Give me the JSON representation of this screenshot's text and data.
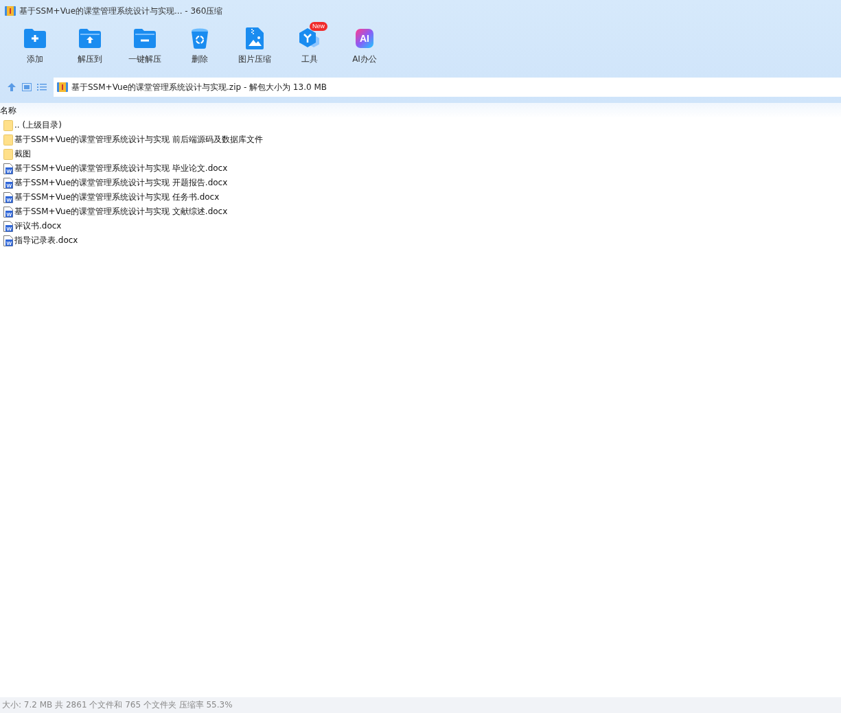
{
  "window": {
    "title": "基于SSM+Vue的课堂管理系统设计与实现... - 360压缩"
  },
  "toolbar": [
    {
      "kind": "add",
      "label": "添加"
    },
    {
      "kind": "extract-to",
      "label": "解压到"
    },
    {
      "kind": "one-click",
      "label": "一键解压"
    },
    {
      "kind": "delete",
      "label": "删除"
    },
    {
      "kind": "image",
      "label": "图片压缩"
    },
    {
      "kind": "tools",
      "label": "工具",
      "badge": "New"
    },
    {
      "kind": "ai",
      "label": "AI办公",
      "icon_text": "AI"
    }
  ],
  "path_bar": {
    "path": "基于SSM+Vue的课堂管理系统设计与实现.zip - 解包大小为 13.0 MB"
  },
  "table": {
    "columns": [
      "名称"
    ],
    "rows": [
      {
        "kind": "folder",
        "name": ".. (上级目录)"
      },
      {
        "kind": "folder",
        "name": "基于SSM+Vue的课堂管理系统设计与实现 前后端源码及数据库文件"
      },
      {
        "kind": "folder",
        "name": "截图"
      },
      {
        "kind": "docx",
        "icon_text": "W",
        "name": "基于SSM+Vue的课堂管理系统设计与实现 毕业论文.docx"
      },
      {
        "kind": "docx",
        "icon_text": "W",
        "name": "基于SSM+Vue的课堂管理系统设计与实现 开题报告.docx"
      },
      {
        "kind": "docx",
        "icon_text": "W",
        "name": "基于SSM+Vue的课堂管理系统设计与实现 任务书.docx"
      },
      {
        "kind": "docx",
        "icon_text": "W",
        "name": "基于SSM+Vue的课堂管理系统设计与实现 文献综述.docx"
      },
      {
        "kind": "docx",
        "icon_text": "W",
        "name": "评议书.docx"
      },
      {
        "kind": "docx",
        "icon_text": "W",
        "name": "指导记录表.docx"
      }
    ]
  },
  "status_bar": "大小: 7.2 MB 共 2861 个文件和 765 个文件夹 压缩率 55.3%"
}
